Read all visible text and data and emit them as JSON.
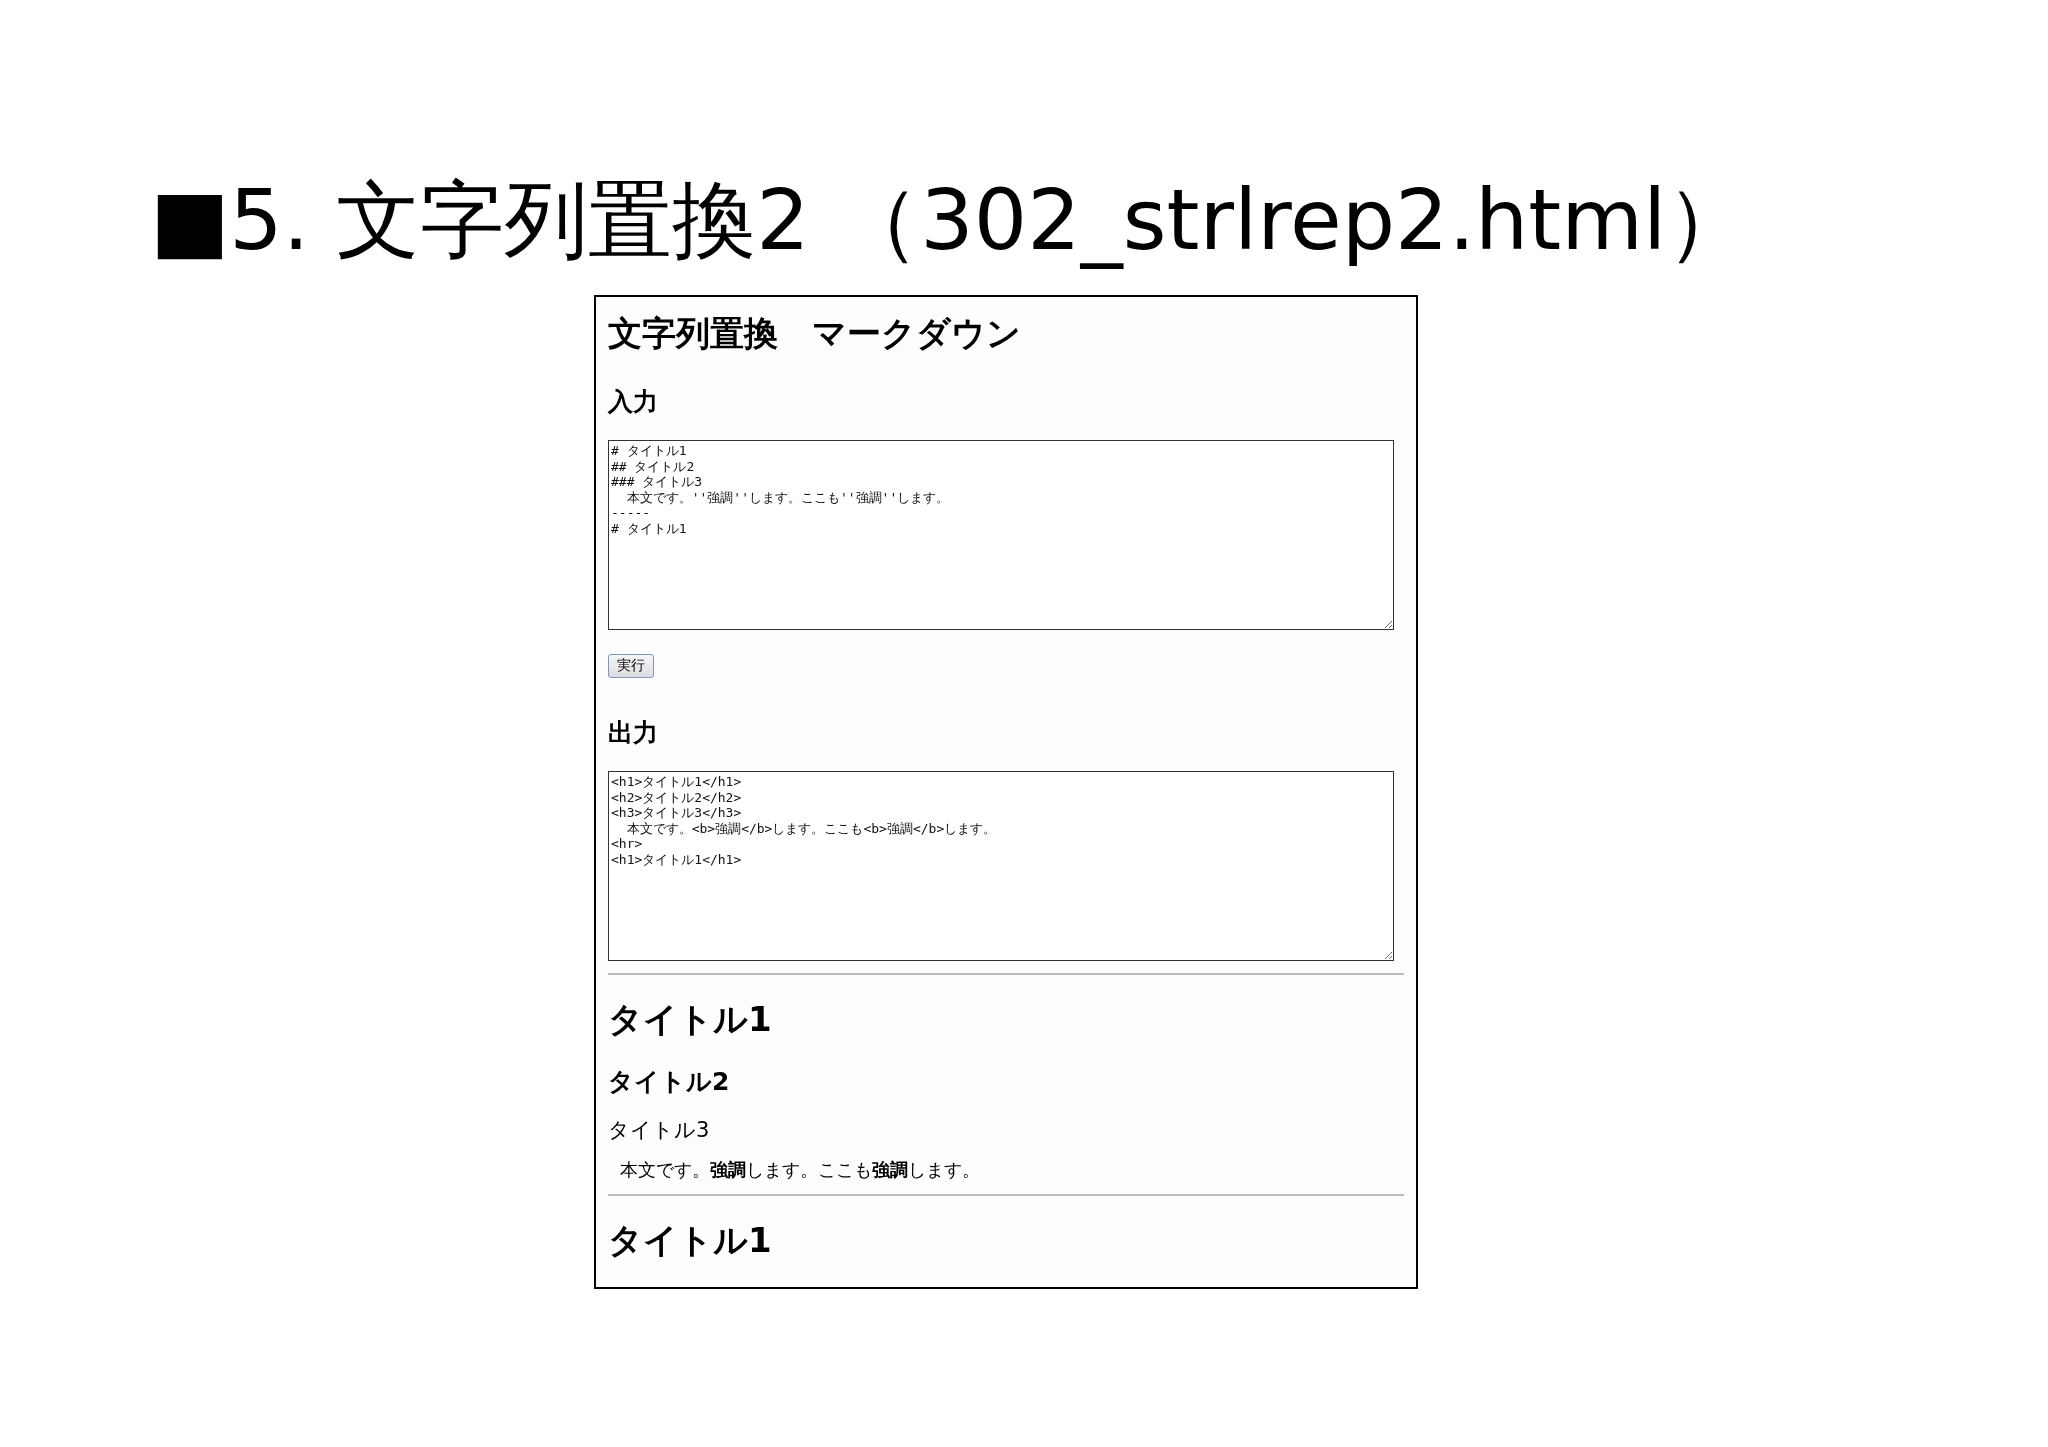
{
  "slide_title": "■5. 文字列置換2 （302_strlrep2.html）",
  "page": {
    "heading": "文字列置換　マークダウン",
    "input_label": "入力",
    "input_lines": [
      "# タイトル1",
      "## タイトル2",
      "### タイトル3",
      "  本文です。''強調''します。ここも''強調''します。",
      "-----",
      "# タイトル1"
    ],
    "run_button": "実行",
    "output_label": "出力",
    "output_lines": [
      "<h1>タイトル1</h1>",
      "<h2>タイトル2</h2>",
      "<h3>タイトル3</h3>",
      "  本文です。<b>強調</b>します。ここも<b>強調</b>します。",
      "<hr>",
      "<h1>タイトル1</h1>"
    ],
    "rendered": [
      {
        "kind": "h1",
        "text": "タイトル1"
      },
      {
        "kind": "h2",
        "text": "タイトル2"
      },
      {
        "kind": "h3",
        "text": "タイトル3"
      },
      {
        "kind": "p",
        "text": "本文です。**強調**します。ここも**強調**します。"
      },
      {
        "kind": "hr"
      },
      {
        "kind": "h1",
        "text": "タイトル1"
      }
    ]
  }
}
